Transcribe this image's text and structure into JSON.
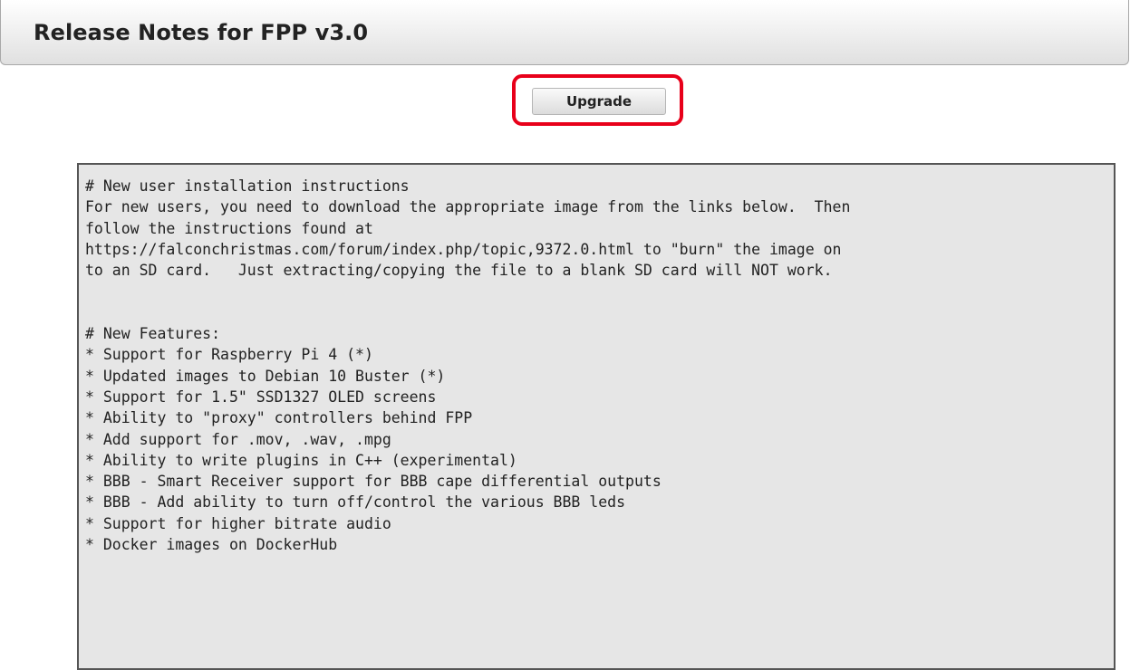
{
  "header": {
    "title": "Release Notes for FPP v3.0"
  },
  "actions": {
    "upgrade_label": "Upgrade"
  },
  "notes": {
    "lines": [
      "# New user installation instructions",
      "For new users, you need to download the appropriate image from the links below.  Then",
      "follow the instructions found at",
      "https://falconchristmas.com/forum/index.php/topic,9372.0.html to \"burn\" the image on",
      "to an SD card.   Just extracting/copying the file to a blank SD card will NOT work.",
      "",
      "",
      "# New Features:",
      "* Support for Raspberry Pi 4 (*)",
      "* Updated images to Debian 10 Buster (*)",
      "* Support for 1.5\" SSD1327 OLED screens",
      "* Ability to \"proxy\" controllers behind FPP",
      "* Add support for .mov, .wav, .mpg",
      "* Ability to write plugins in C++ (experimental)",
      "* BBB - Smart Receiver support for BBB cape differential outputs",
      "* BBB - Add ability to turn off/control the various BBB leds",
      "* Support for higher bitrate audio",
      "* Docker images on DockerHub"
    ]
  },
  "colors": {
    "highlight": "#e8001a",
    "notes_background": "#e6e6e6"
  }
}
